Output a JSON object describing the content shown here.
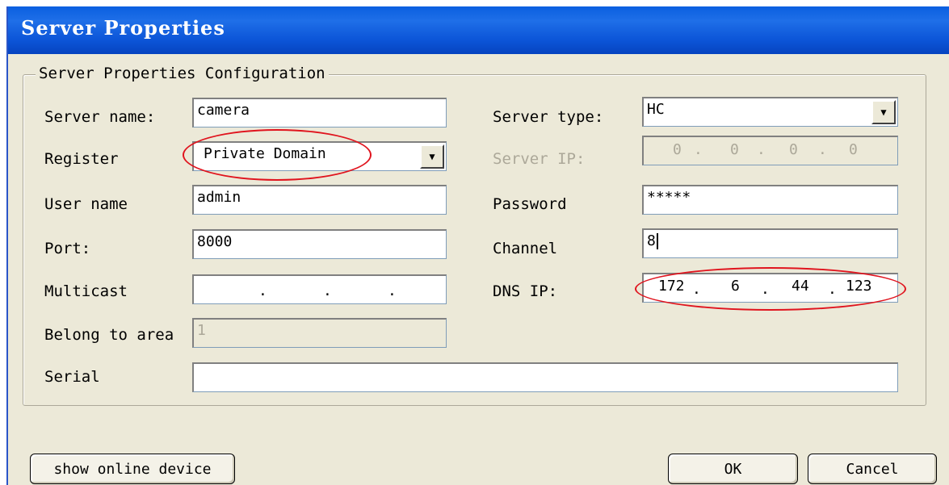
{
  "window": {
    "title": "Server Properties"
  },
  "group": {
    "legend": "Server Properties Configuration"
  },
  "labels": {
    "server_name": "Server name:",
    "register": "Register",
    "user_name": "User name",
    "port": "Port:",
    "multicast": "Multicast",
    "belong_to_area": "Belong to area",
    "serial": "Serial",
    "server_type": "Server type:",
    "server_ip": "Server IP:",
    "password": "Password",
    "channel": "Channel",
    "dns_ip": "DNS IP:"
  },
  "values": {
    "server_name": "camera",
    "register": "Private Domain",
    "user_name": "admin",
    "port": "8000",
    "multicast": [
      "",
      "",
      "",
      ""
    ],
    "multicast_sep": ".",
    "belong_to_area": "1",
    "serial": "",
    "server_type": "HC",
    "server_ip": [
      "0",
      "0",
      "0",
      "0"
    ],
    "password": "*****",
    "channel": "8",
    "dns_ip": [
      "172",
      "6",
      "44",
      "123"
    ]
  },
  "buttons": {
    "show_online_device": "show online device",
    "ok": "OK",
    "cancel": "Cancel"
  },
  "icons": {
    "dropdown": "chevron-down-icon"
  },
  "colors": {
    "title_bar": "#0a5fe0",
    "annotation": "#e0141e",
    "dialog_bg": "#ece9d8"
  }
}
